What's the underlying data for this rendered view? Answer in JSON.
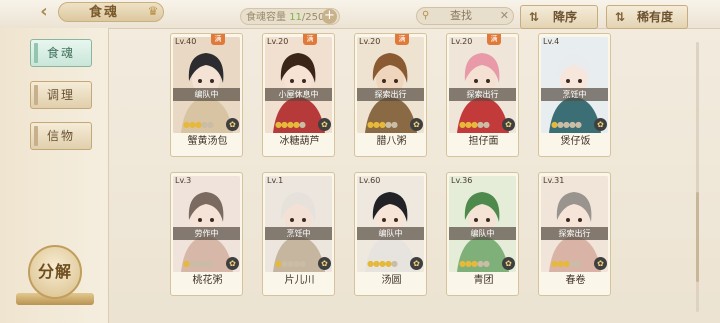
{
  "header": {
    "title": "食魂",
    "capacity_label": "食魂容量",
    "capacity_current": "11",
    "capacity_max": "/250",
    "search_label": "查找",
    "sort_label": "降序",
    "rarity_label": "稀有度"
  },
  "sidebar": {
    "tabs": [
      {
        "label": "食魂",
        "active": true
      },
      {
        "label": "调理",
        "active": false
      },
      {
        "label": "信物",
        "active": false
      }
    ],
    "decompose_label": "分解"
  },
  "cards": [
    {
      "level": "Lv.40",
      "full": "满",
      "status": "编队中",
      "role": "",
      "stars": 3,
      "name": "蟹黄汤包",
      "hair": "#2b2b30",
      "bg": "#e8d8c4",
      "skin": "#f4e2d4",
      "cloth": "#d8c3a2"
    },
    {
      "level": "Lv.20",
      "full": "满",
      "status": "小屋休息中",
      "role": "",
      "stars": 4,
      "name": "冰糖葫芦",
      "hair": "#3b2418",
      "bg": "#f1dfcf",
      "skin": "#f6e3d3",
      "cloth": "#b63a3a"
    },
    {
      "level": "Lv.20",
      "full": "满",
      "status": "探索出行",
      "role": "",
      "stars": 3,
      "name": "腊八粥",
      "hair": "#8a5a32",
      "bg": "#eee2d0",
      "skin": "#f0d5bd",
      "cloth": "#8a6a44"
    },
    {
      "level": "Lv.20",
      "full": "满",
      "status": "探索出行",
      "role": "",
      "stars": 3,
      "name": "担仔面",
      "hair": "#e89aa8",
      "bg": "#efe5d8",
      "skin": "#f5e1d4",
      "cloth": "#c23a3a"
    },
    {
      "level": "Lv.4",
      "full": "",
      "status": "烹饪中",
      "role": "",
      "stars": 1,
      "name": "煲仔饭",
      "hair": "#e9ecef",
      "bg": "#e8eef0",
      "skin": "#f6e6dc",
      "cloth": "#3b6e75"
    },
    {
      "level": "Lv.3",
      "full": "",
      "status": "劳作中",
      "role": "",
      "stars": 1,
      "name": "桃花粥",
      "hair": "#7a6a5f",
      "bg": "#f0e3dc",
      "skin": "#f5e3d8",
      "cloth": "#d7b7a8"
    },
    {
      "level": "Lv.1",
      "full": "",
      "status": "烹饪中",
      "role": "",
      "stars": 1,
      "name": "片儿川",
      "hair": "#e6e1db",
      "bg": "#ede6de",
      "skin": "#f3e1d6",
      "cloth": "#c6b6a0"
    },
    {
      "level": "Lv.60",
      "full": "",
      "status": "编队中",
      "role": "",
      "stars": 4,
      "name": "汤圆",
      "hair": "#222226",
      "bg": "#efe8de",
      "skin": "#f7e5d8",
      "cloth": "#e7e4e0"
    },
    {
      "level": "Lv.36",
      "full": "",
      "status": "编队中",
      "role": "",
      "stars": 3,
      "name": "青团",
      "hair": "#4d8a4b",
      "bg": "#e5ecd8",
      "skin": "#f5e3d6",
      "cloth": "#7fb07a"
    },
    {
      "level": "Lv.31",
      "full": "",
      "status": "探索出行",
      "role": "",
      "stars": 3,
      "name": "春卷",
      "hair": "#9a948e",
      "bg": "#f1e4d8",
      "skin": "#f6e4d8",
      "cloth": "#d9b3a6"
    }
  ],
  "colors": {
    "accent": "#c3a978",
    "active_tab": "#93c6ae",
    "star": "#e6b93a"
  }
}
